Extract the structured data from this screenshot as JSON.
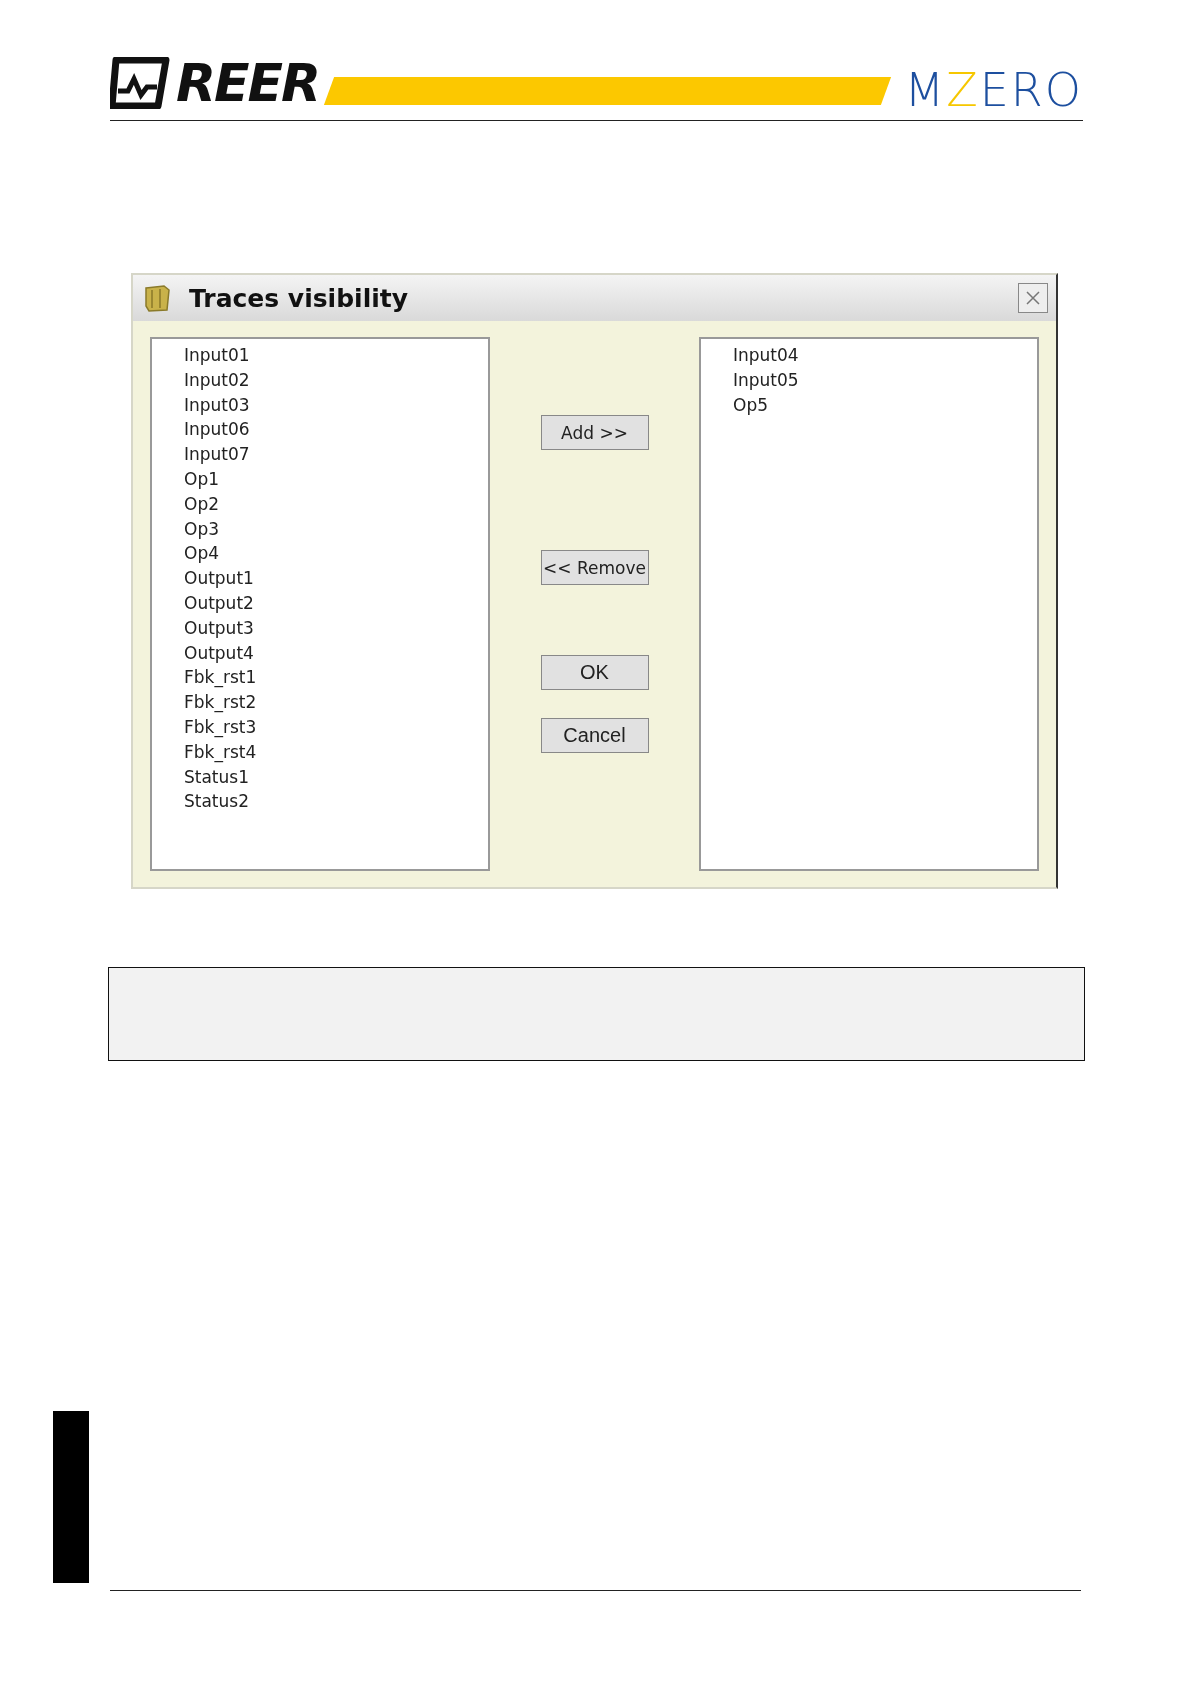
{
  "header": {
    "brand": "REER",
    "product": [
      {
        "text": "M",
        "color": "#1d4f9f"
      },
      {
        "text": "Z",
        "color": "#f6c700"
      },
      {
        "text": "ERO",
        "color": "#1d4f9f"
      }
    ]
  },
  "dialog": {
    "title": "Traces visibility",
    "available": [
      "Input01",
      "Input02",
      "Input03",
      "Input06",
      "Input07",
      "Op1",
      "Op2",
      "Op3",
      "Op4",
      "Output1",
      "Output2",
      "Output3",
      "Output4",
      "Fbk_rst1",
      "Fbk_rst2",
      "Fbk_rst3",
      "Fbk_rst4",
      "Status1",
      "Status2"
    ],
    "visible": [
      "Input04",
      "Input05",
      "Op5"
    ],
    "buttons": [
      {
        "label": "Add >>",
        "kind": "move"
      },
      {
        "label": "<< Remove",
        "kind": "move"
      },
      {
        "label": "OK",
        "kind": "confirm"
      },
      {
        "label": "Cancel",
        "kind": "confirm"
      }
    ]
  }
}
